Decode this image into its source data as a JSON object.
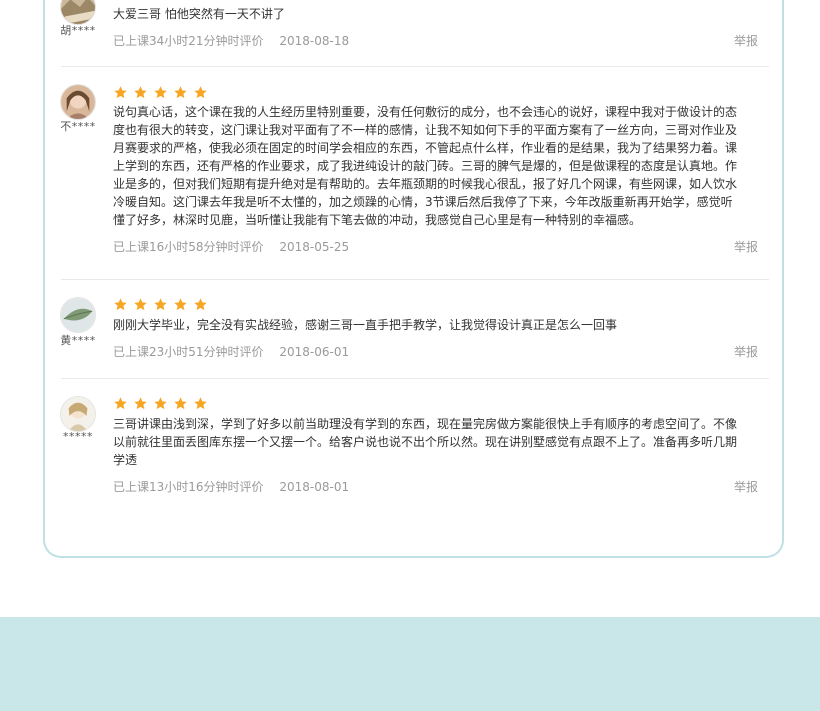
{
  "reviews": [
    {
      "user": "胡****",
      "avatar": "landscape-avatar",
      "stars": 0,
      "text": "大爱三哥 怕他突然有一天不讲了",
      "time": "已上课34小时21分钟时评价",
      "date": "2018-08-18",
      "report": "举报"
    },
    {
      "user": "不****",
      "avatar": "girl-portrait-avatar",
      "stars": 5,
      "text": "说句真心话，这个课在我的人生经历里特别重要，没有任何敷衍的成分，也不会违心的说好，课程中我对于做设计的态度也有很大的转变，这门课让我对平面有了不一样的感情，让我不知如何下手的平面方案有了一丝方向，三哥对作业及月赛要求的严格，使我必须在固定的时间学会相应的东西，不管起点什么样，作业看的是结果，我为了结果努力着。课上学到的东西，还有严格的作业要求，成了我进纯设计的敲门砖。三哥的脾气是爆的，但是做课程的态度是认真地。作业是多的，但对我们短期有提升绝对是有帮助的。去年瓶颈期的时候我心很乱，报了好几个网课，有些网课，如人饮水冷暖自知。这门课去年我是听不太懂的，加之烦躁的心情，3节课后然后我停了下来，今年改版重新再开始学，感觉听懂了好多，林深时见鹿，当听懂让我能有下笔去做的冲动，我感觉自己心里是有一种特别的幸福感。",
      "time": "已上课16小时58分钟时评价",
      "date": "2018-05-25",
      "report": "举报"
    },
    {
      "user": "黄****",
      "avatar": "leaf-avatar",
      "stars": 5,
      "text": "刚刚大学毕业，完全没有实战经验，感谢三哥一直手把手教学，让我觉得设计真正是怎么一回事",
      "time": "已上课23小时51分钟时评价",
      "date": "2018-06-01",
      "report": "举报"
    },
    {
      "user": "*****",
      "avatar": "illustration-avatar",
      "stars": 5,
      "text": "三哥讲课由浅到深，学到了好多以前当助理没有学到的东西，现在量完房做方案能很快上手有顺序的考虑空间了。不像以前就往里面丢图库东摆一个又摆一个。给客户说也说不出个所以然。现在讲别墅感觉有点跟不上了。准备再多听几期学透",
      "time": "已上课13小时16分钟时评价",
      "date": "2018-08-01",
      "report": "举报"
    }
  ],
  "colors": {
    "star": "#f6a623",
    "card_border": "#bfe0e4",
    "footer": "#c9e6e8",
    "meta": "#9a9a9a"
  }
}
